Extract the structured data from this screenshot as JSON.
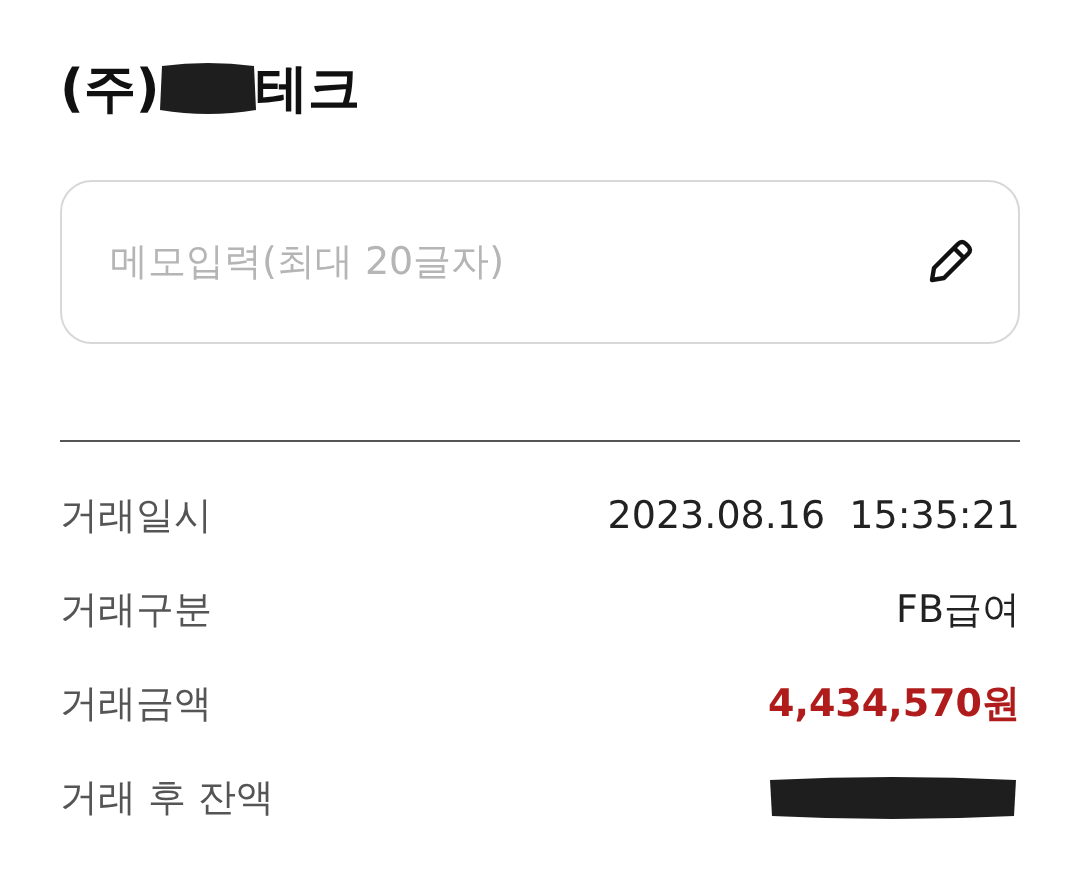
{
  "title": {
    "prefix": "(주)",
    "suffix": "테크",
    "redacted": true
  },
  "memo": {
    "placeholder": "메모입력(최대 20글자)"
  },
  "details": [
    {
      "label": "거래일시",
      "kind": "text",
      "value": "2023.08.16  15:35:21"
    },
    {
      "label": "거래구분",
      "kind": "text",
      "value": "FB급여"
    },
    {
      "label": "거래금액",
      "kind": "amount",
      "value": "4,434,570원"
    },
    {
      "label": "거래 후 잔액",
      "kind": "redacted"
    }
  ]
}
